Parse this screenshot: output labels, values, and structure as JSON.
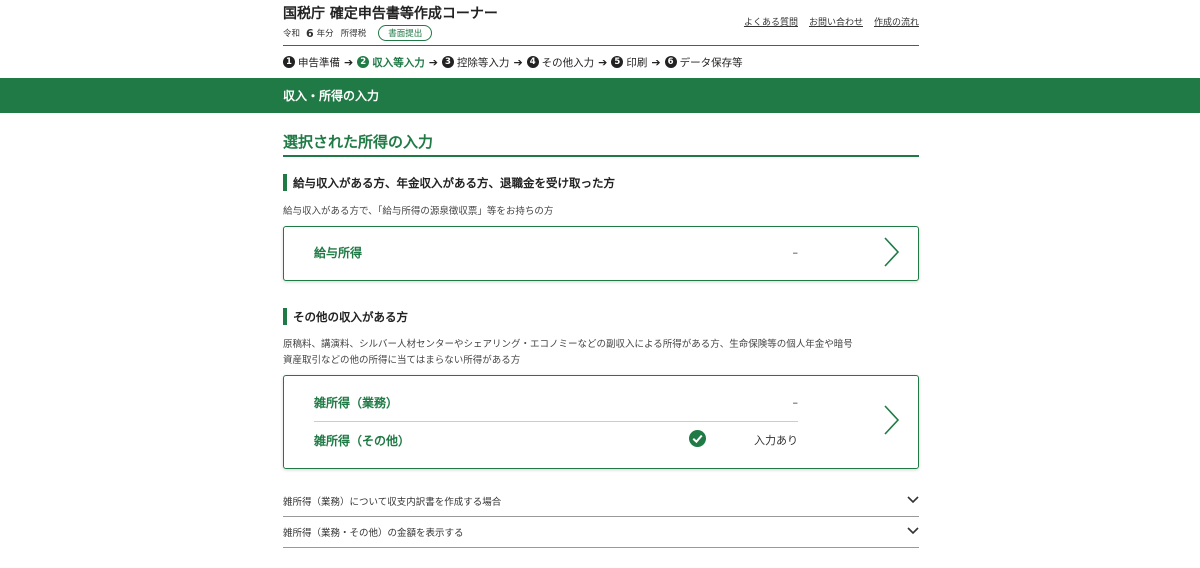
{
  "header": {
    "site_title": "国税庁 確定申告書等作成コーナー",
    "era": "令和",
    "year": "6",
    "year_unit": "年分",
    "tax_type": "所得税",
    "submit_badge": "書面提出",
    "links": [
      "よくある質問",
      "お問い合わせ",
      "作成の流れ"
    ]
  },
  "steps": [
    {
      "num": "1",
      "label": "申告準備",
      "active": false
    },
    {
      "num": "2",
      "label": "収入等入力",
      "active": true
    },
    {
      "num": "3",
      "label": "控除等入力",
      "active": false
    },
    {
      "num": "4",
      "label": "その他入力",
      "active": false
    },
    {
      "num": "5",
      "label": "印刷",
      "active": false
    },
    {
      "num": "6",
      "label": "データ保存等",
      "active": false
    }
  ],
  "step_arrow": "➔",
  "band": {
    "title": "収入・所得の入力"
  },
  "section": {
    "title": "選択された所得の入力"
  },
  "salary_group": {
    "heading": "給与収入がある方、年金収入がある方、退職金を受け取った方",
    "description": "給与収入がある方で、「給与所得の源泉徴収票」等をお持ちの方",
    "card": {
      "label": "給与所得",
      "status": "–"
    }
  },
  "other_group": {
    "heading": "その他の収入がある方",
    "description_line1": "原稿料、講演料、シルバー人材センターやシェアリング・エコノミーなどの副収入による所得がある方、生命保険等の個人年金や暗号",
    "description_line2": "資産取引などの他の所得に当てはまらない所得がある方",
    "rows": [
      {
        "label": "雑所得（業務）",
        "status": "–"
      },
      {
        "label": "雑所得（その他）",
        "status": "入力あり"
      }
    ]
  },
  "accordions": [
    {
      "label": "雑所得（業務）について収支内訳書を作成する場合"
    },
    {
      "label": "雑所得（業務・その他）の金額を表示する"
    }
  ],
  "colors": {
    "primary": "#1f7a45",
    "text": "#333333"
  },
  "icons": {
    "card_arrow": "chevron-right-icon",
    "accordion": "chevron-down-icon",
    "status_done": "check-circle-icon"
  }
}
